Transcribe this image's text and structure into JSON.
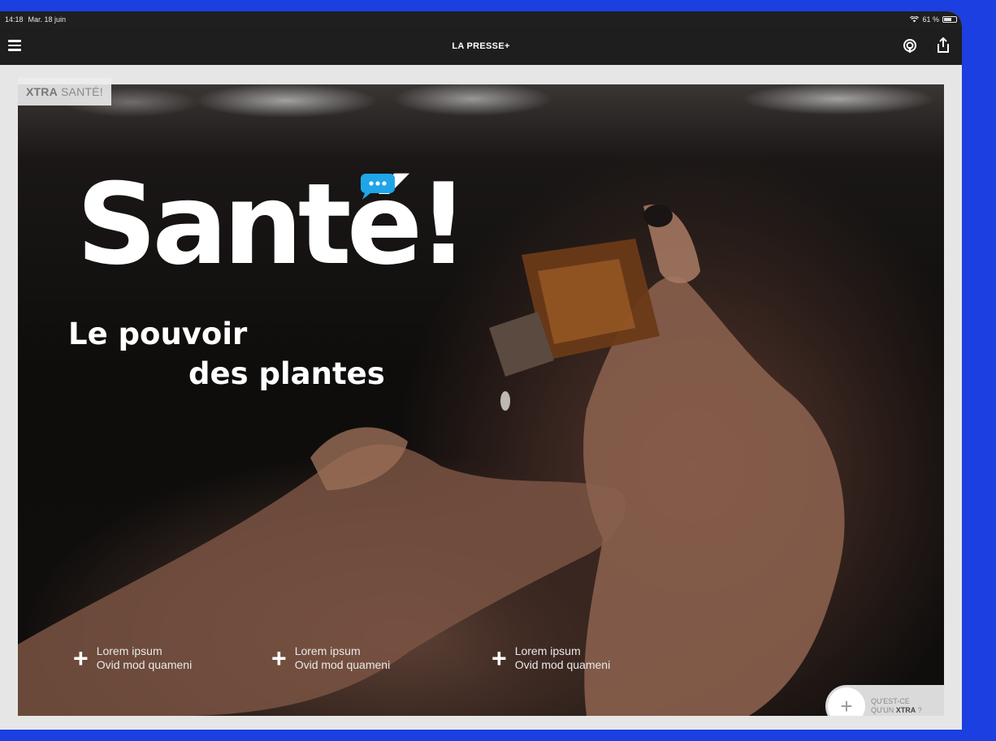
{
  "status_bar": {
    "time": "14:18",
    "date": "Mar. 18 juin",
    "battery": "61 %"
  },
  "nav": {
    "title": "LA PRESSE+"
  },
  "section_tag": {
    "bold": "XTRA",
    "rest": "SANTÉ!"
  },
  "hero": {
    "headline": "Santé!",
    "subtitle_line1": "Le pouvoir",
    "subtitle_line2": "des plantes"
  },
  "links": [
    {
      "line1": "Lorem ipsum",
      "line2": "Ovid mod quameni"
    },
    {
      "line1": "Lorem ipsum",
      "line2": "Ovid mod quameni"
    },
    {
      "line1": "Lorem ipsum",
      "line2": "Ovid mod quameni"
    }
  ],
  "xtra_info": {
    "line1": "QU'EST-CE",
    "line2_prefix": "QU'UN",
    "line2_bold": "XTRA",
    "line2_suffix": "?"
  },
  "colors": {
    "background": "#1b3fe0",
    "navbar": "#1e1e1e",
    "chat_bubble": "#1fa6e8"
  },
  "icons": [
    "menu-icon",
    "podcast-icon",
    "share-icon",
    "wifi-icon",
    "battery-icon",
    "chat-bubble-icon",
    "plus-icon"
  ]
}
